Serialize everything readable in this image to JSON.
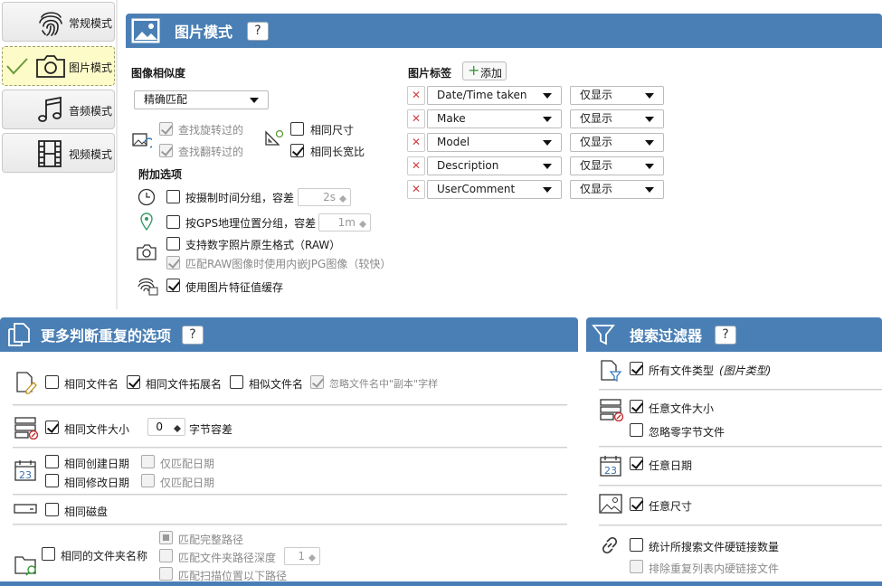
{
  "tabs": [
    {
      "label": "常规模式",
      "icon": "fingerprint-icon",
      "selected": false
    },
    {
      "label": "图片模式",
      "icon": "camera-icon",
      "selected": true
    },
    {
      "label": "音频模式",
      "icon": "music-note-icon",
      "selected": false
    },
    {
      "label": "视频模式",
      "icon": "film-icon",
      "selected": false
    }
  ],
  "picture_panel": {
    "title": "图片模式",
    "help": "?",
    "similarity_label": "图像相似度",
    "similarity_value": "精确匹配",
    "rotated": "查找旋转过的",
    "flipped": "查找翻转过的",
    "same_size": "相同尺寸",
    "same_aspect": "相同长宽比",
    "extra_label": "附加选项",
    "group_time": "按摄制时间分组，容差",
    "group_time_val": "2s",
    "group_gps": "按GPS地理位置分组，容差",
    "group_gps_val": "1m",
    "raw": "支持数字照片原生格式（RAW）",
    "raw_jpg": "匹配RAW图像时使用内嵌JPG图像（较快）",
    "cache": "使用图片特征值缓存",
    "tags_label": "图片标签",
    "add_label": "添加",
    "tags": [
      {
        "name": "Date/Time taken",
        "mode": "仅显示"
      },
      {
        "name": "Make",
        "mode": "仅显示"
      },
      {
        "name": "Model",
        "mode": "仅显示"
      },
      {
        "name": "Description",
        "mode": "仅显示"
      },
      {
        "name": "UserComment",
        "mode": "仅显示"
      }
    ]
  },
  "dup_panel": {
    "title": "更多判断重复的选项",
    "help": "?",
    "same_name": "相同文件名",
    "same_ext": "相同文件拓展名",
    "similar_name": "相似文件名",
    "ignore_copy": "忽略文件名中\"副本\"字样",
    "same_size": "相同文件大小",
    "size_tol": "0",
    "size_tol_label": "字节容差",
    "same_created": "相同创建日期",
    "same_modified": "相同修改日期",
    "date_only1": "仅匹配日期",
    "date_only2": "仅匹配日期",
    "same_disk": "相同磁盘",
    "same_folder": "相同的文件夹名称",
    "full_path": "匹配完整路径",
    "path_depth": "匹配文件夹路径深度",
    "depth_val": "1",
    "below_path": "匹配扫描位置以下路径"
  },
  "filter_panel": {
    "title": "搜索过滤器",
    "help": "?",
    "all_types": "所有文件类型",
    "all_types_note": "(图片类型)",
    "any_size": "任意文件大小",
    "ignore_zero": "忽略零字节文件",
    "any_date": "任意日期",
    "any_dim": "任意尺寸",
    "count_hardlinks": "统计所搜索文件硬链接数量",
    "exclude_hardlinks": "排除重复列表内硬链接文件"
  },
  "colors": {
    "header": "#4a7fb5",
    "tab_selected": "#fdfcc8",
    "check_green": "#5a9a3a"
  }
}
